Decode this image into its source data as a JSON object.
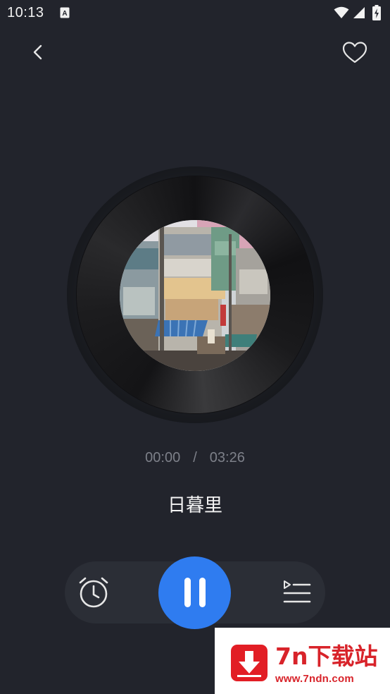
{
  "status_bar": {
    "time": "10:13",
    "notification_icon": "a-notification-icon",
    "icons": [
      "wifi-icon",
      "signal-icon",
      "battery-charging-icon"
    ]
  },
  "header": {
    "back_icon": "chevron-left-icon",
    "favorite_icon": "heart-outline-icon"
  },
  "player": {
    "current_time": "00:00",
    "separator": "/",
    "total_time": "03:26",
    "song_title": "日暮里",
    "album_art_desc": "album-cover-image"
  },
  "controls": {
    "timer_icon": "alarm-clock-icon",
    "play_pause_icon": "pause-icon",
    "playlist_icon": "playlist-icon",
    "accent_color": "#2f7cf0"
  },
  "watermark": {
    "name": "7n下载站",
    "url": "www.7ndn.com",
    "color": "#d8232a"
  }
}
